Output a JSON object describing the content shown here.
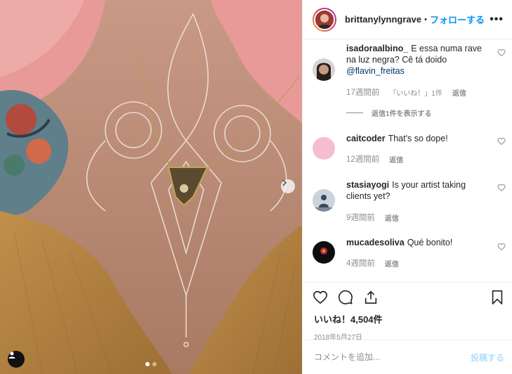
{
  "header": {
    "username": "brittanylynngrave",
    "separator": "•",
    "follow_label": "フォローする",
    "more_icon": "more-options-icon"
  },
  "comments": [
    {
      "username": "isadoraalbino_",
      "text": "E essa numa rave na luz negra? Cê tá doido",
      "mention": "@flavin_freitas",
      "age": "17週間前",
      "likes": "「いいね！」1件",
      "reply_label": "返信",
      "view_replies": "返信1件を表示する"
    },
    {
      "username": "caitcoder",
      "text": "That's so dope!",
      "age": "12週間前",
      "reply_label": "返信"
    },
    {
      "username": "stasiayogi",
      "text": "Is your artist taking clients yet?",
      "age": "9週間前",
      "reply_label": "返信"
    },
    {
      "username": "mucadesoliva",
      "text": "Qué bonito!",
      "age": "4週間前",
      "reply_label": "返信"
    }
  ],
  "post": {
    "likes_count": "いいね！4,504件",
    "date": "2018年5月27日"
  },
  "comment_input": {
    "placeholder": "コメントを追加...",
    "post_label": "投稿する"
  },
  "colors": {
    "link_blue": "#0095f6",
    "post_disabled": "#b2dffc",
    "meta_gray": "#8e8e8e",
    "mustard_top": "#b98a4a",
    "hair_pink": "#e8a0a0"
  },
  "carousel": {
    "total_slides": 2,
    "active_slide": 1
  }
}
